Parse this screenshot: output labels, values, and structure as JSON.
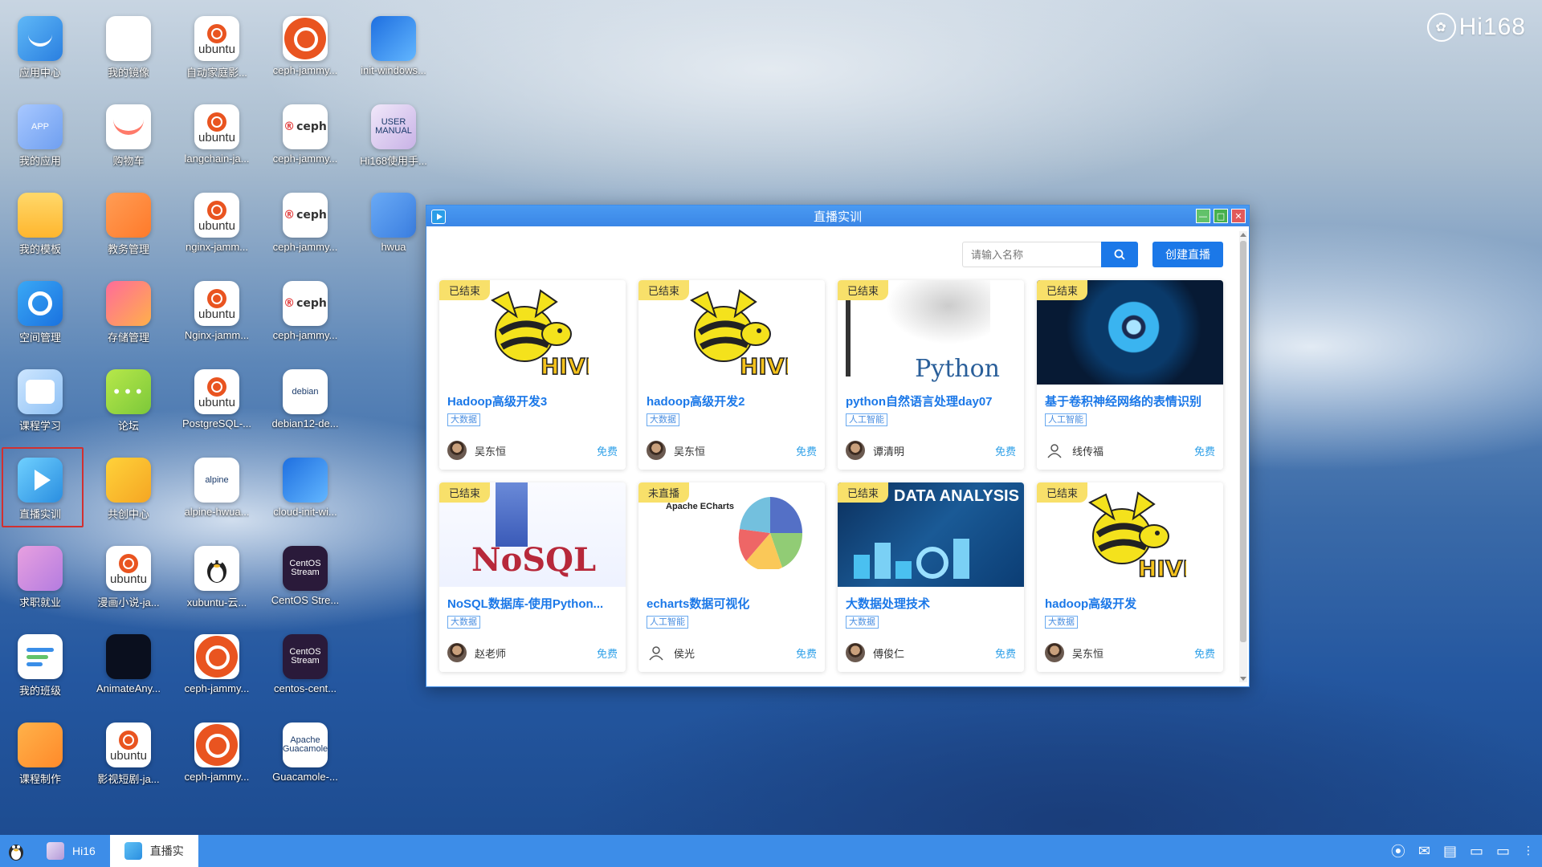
{
  "brand": "Hi168",
  "desktop_icons": [
    {
      "label": "应用中心",
      "icon": "app-center-icon"
    },
    {
      "label": "我的镜像",
      "icon": "mirror-icon"
    },
    {
      "label": "自动家庭影...",
      "icon": "ubuntu-icon"
    },
    {
      "label": "ceph-jammy...",
      "icon": "ubuntu-big-icon"
    },
    {
      "label": "init-windows...",
      "icon": "windows-icon"
    },
    {
      "label": "我的应用",
      "icon": "my-apps-icon",
      "text": "APP"
    },
    {
      "label": "购物车",
      "icon": "cart-icon"
    },
    {
      "label": "langchain-ja...",
      "icon": "ubuntu-icon"
    },
    {
      "label": "ceph-jammy...",
      "icon": "ceph-icon"
    },
    {
      "label": "Hi168使用手...",
      "icon": "manual-icon",
      "text": "USER MANUAL"
    },
    {
      "label": "我的模板",
      "icon": "folder-icon"
    },
    {
      "label": "教务管理",
      "icon": "academic-icon"
    },
    {
      "label": "nginx-jamm...",
      "icon": "ubuntu-icon"
    },
    {
      "label": "ceph-jammy...",
      "icon": "ceph-icon"
    },
    {
      "label": "hwua",
      "icon": "hwua-icon"
    },
    {
      "label": "空间管理",
      "icon": "space-icon"
    },
    {
      "label": "存储管理",
      "icon": "storage-icon"
    },
    {
      "label": "Nginx-jamm...",
      "icon": "ubuntu-icon"
    },
    {
      "label": "ceph-jammy...",
      "icon": "ceph-icon"
    },
    {
      "label": "课程学习",
      "icon": "course-icon"
    },
    {
      "label": "论坛",
      "icon": "forum-icon"
    },
    {
      "label": "PostgreSQL-...",
      "icon": "ubuntu-icon"
    },
    {
      "label": "debian12-de...",
      "icon": "debian-icon",
      "text": "debian"
    },
    {
      "label": "直播实训",
      "icon": "live-icon"
    },
    {
      "label": "共创中心",
      "icon": "cocreate-icon"
    },
    {
      "label": "alpine-hwua...",
      "icon": "alpine-icon",
      "text": "alpine"
    },
    {
      "label": "cloud-init-wi...",
      "icon": "windows-icon"
    },
    {
      "label": "求职就业",
      "icon": "job-icon"
    },
    {
      "label": "漫画小说-ja...",
      "icon": "ubuntu-icon"
    },
    {
      "label": "xubuntu-云...",
      "icon": "linux-icon"
    },
    {
      "label": "CentOS Stre...",
      "icon": "centos-icon",
      "text": "CentOS Stream"
    },
    {
      "label": "我的班级",
      "icon": "class-icon"
    },
    {
      "label": "AnimateAny...",
      "icon": "animate-icon"
    },
    {
      "label": "ceph-jammy...",
      "icon": "ubuntu-big-icon"
    },
    {
      "label": "centos-cent...",
      "icon": "centos-icon",
      "text": "CentOS Stream"
    },
    {
      "label": "课程制作",
      "icon": "course-make-icon"
    },
    {
      "label": "影视短剧-ja...",
      "icon": "ubuntu-icon"
    },
    {
      "label": "ceph-jammy...",
      "icon": "ubuntu-big-icon"
    },
    {
      "label": "Guacamole-...",
      "icon": "guacamole-icon",
      "text": "Apache Guacamole"
    }
  ],
  "window": {
    "title": "直播实训",
    "search_placeholder": "请输入名称",
    "create_button": "创建直播",
    "cards": [
      {
        "status": "已结束",
        "title": "Hadoop高级开发3",
        "tag": "大数据",
        "author": "吴东恒",
        "price": "免费",
        "art": "hive"
      },
      {
        "status": "已结束",
        "title": "hadoop高级开发2",
        "tag": "大数据",
        "author": "吴东恒",
        "price": "免费",
        "art": "hive"
      },
      {
        "status": "已结束",
        "title": "python自然语言处理day07",
        "tag": "人工智能",
        "author": "谭清明",
        "price": "免费",
        "art": "python",
        "art_text": "Python"
      },
      {
        "status": "已结束",
        "title": "基于卷积神经网络的表情识别",
        "tag": "人工智能",
        "author": "线传福",
        "price": "免费",
        "art": "eye"
      },
      {
        "status": "已结束",
        "title": "NoSQL数据库-使用Python...",
        "tag": "大数据",
        "author": "赵老师",
        "price": "免费",
        "art": "nosql",
        "art_text": "NoSQL"
      },
      {
        "status": "未直播",
        "title": "echarts数据可视化",
        "tag": "人工智能",
        "author": "侯光",
        "price": "免费",
        "art": "echarts",
        "art_text": "Apache ECharts"
      },
      {
        "status": "已结束",
        "title": "大数据处理技术",
        "tag": "大数据",
        "author": "傅俊仁",
        "price": "免费",
        "art": "data",
        "art_text": "DATA ANALYSIS"
      },
      {
        "status": "已结束",
        "title": "hadoop高级开发",
        "tag": "大数据",
        "author": "吴东恒",
        "price": "免费",
        "art": "hive"
      }
    ]
  },
  "taskbar": {
    "items": [
      {
        "label": "Hi16",
        "active": false
      },
      {
        "label": "直播实",
        "active": true
      }
    ]
  },
  "colors": {
    "accent": "#1b78e8",
    "titlebar": "#3d8de8",
    "badge": "#f8e06a"
  }
}
